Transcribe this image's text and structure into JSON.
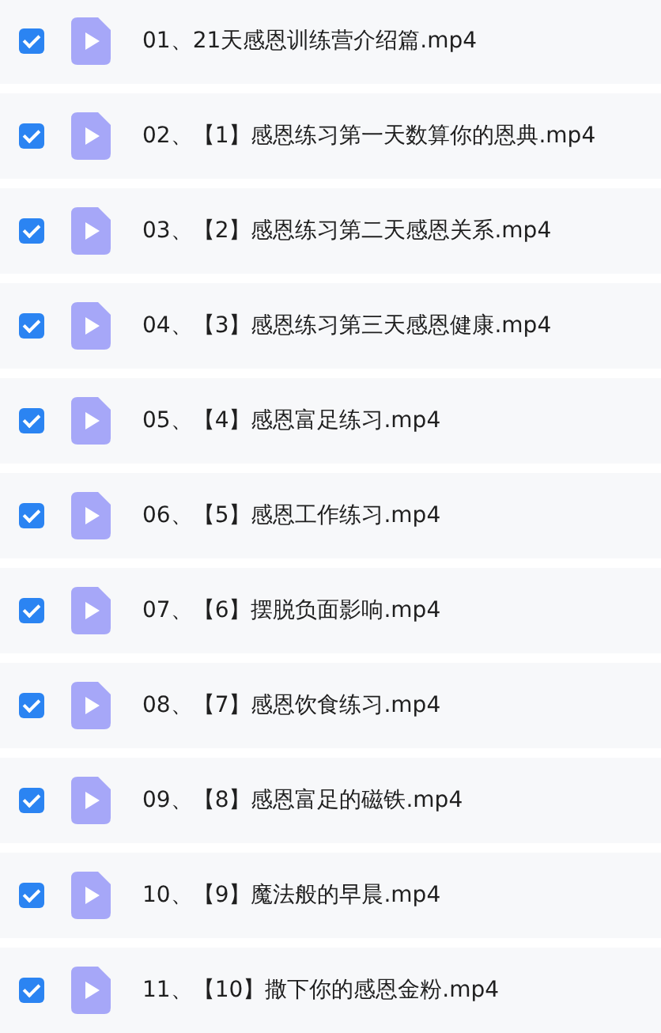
{
  "files": [
    {
      "name": "01、21天感恩训练营介绍篇.mp4",
      "checked": true
    },
    {
      "name": "02、【1】感恩练习第一天数算你的恩典.mp4",
      "checked": true
    },
    {
      "name": "03、【2】感恩练习第二天感恩关系.mp4",
      "checked": true
    },
    {
      "name": "04、【3】感恩练习第三天感恩健康.mp4",
      "checked": true
    },
    {
      "name": "05、【4】感恩富足练习.mp4",
      "checked": true
    },
    {
      "name": "06、【5】感恩工作练习.mp4",
      "checked": true
    },
    {
      "name": "07、【6】摆脱负面影响.mp4",
      "checked": true
    },
    {
      "name": "08、【7】感恩饮食练习.mp4",
      "checked": true
    },
    {
      "name": "09、【8】感恩富足的磁铁.mp4",
      "checked": true
    },
    {
      "name": "10、【9】魔法般的早晨.mp4",
      "checked": true
    },
    {
      "name": "11、【10】撒下你的感恩金粉.mp4",
      "checked": true
    }
  ]
}
